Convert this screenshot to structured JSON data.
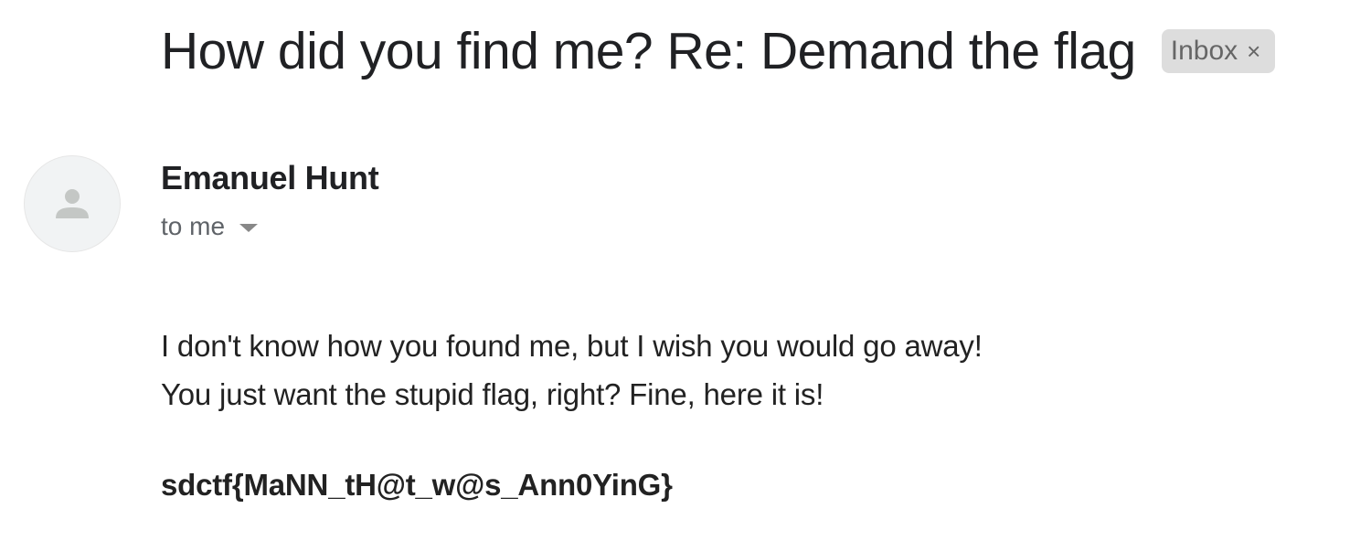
{
  "email": {
    "subject": "How did you find me? Re: Demand the flag",
    "label": {
      "text": "Inbox",
      "close_glyph": "×"
    },
    "sender": {
      "name": "Emanuel Hunt",
      "avatar_icon": "person-icon"
    },
    "recipients_text": "to me",
    "recipients_icon": "caret-down-icon",
    "body_lines": [
      "I don't know how you found me, but I wish you would go away!",
      "You just want the stupid flag, right? Fine, here it is!"
    ],
    "flag": "sdctf{MaNN_tH@t_w@s_Ann0YinG}"
  },
  "colors": {
    "text_primary": "#202124",
    "text_secondary": "#5f6368",
    "chip_bg": "#dddddd",
    "avatar_bg": "#f1f3f4",
    "avatar_icon": "#c4c7c5"
  }
}
